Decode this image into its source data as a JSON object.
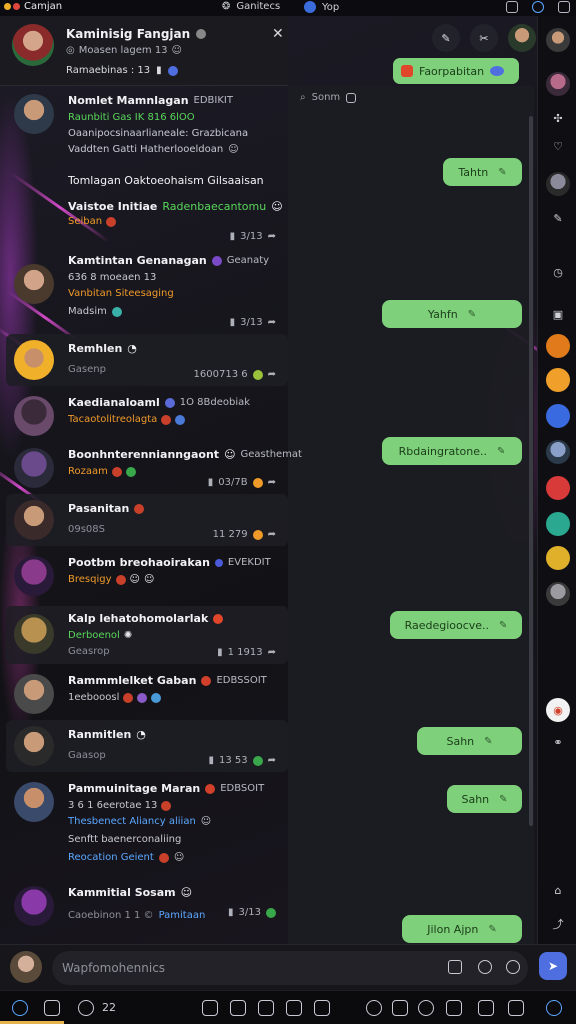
{
  "window": {
    "app_title": "Camjan",
    "tab1": "Ganitecs",
    "tab2": "Yop"
  },
  "chat_header": {
    "name": "Kaminisig Fangjan",
    "sub": "Moasen lagem 13",
    "meta": "Ramaebinas : 13"
  },
  "chats": [
    {
      "t1": "Nomlet Mamnlagan",
      "extra": "EDBIKIT",
      "t2": "Raunbiti Gas IK 816 6lOO",
      "t3": "Oaanipocsinaarlianeale: Grazbicana",
      "t4": "Vaddten Gatti Hatherlooeldoan"
    },
    {
      "t1": "Tomlagan Oaktoeohaism Gilsaaisan"
    },
    {
      "t1": "Vaistoe Initiae",
      "extra": "Radenbaecantomu",
      "t2": "Seiban",
      "meta": "3/13"
    },
    {
      "t1": "Kamtintan Genanagan",
      "extra": "Geanaty",
      "t2": "636 8 moeaen 13",
      "t3": "Vanbitan Siteesaging",
      "t4": "Madsim",
      "meta": "3/13"
    },
    {
      "t1": "Remhlen",
      "t3": "Gasenp",
      "meta": "1600713 6"
    },
    {
      "t1": "Kaedianaloaml",
      "extra": "1O 8Bdeobiak",
      "t2": "Tacaotolitreolagta"
    },
    {
      "t1": "Boonhnterennianngaont",
      "extra": "Geasthemat",
      "t2": "Rozaam",
      "meta": "03/7B"
    },
    {
      "t1": "Pasanitan",
      "t3": "09s08S",
      "meta": "11 279"
    },
    {
      "t1": "Pootbm breohaoirakan",
      "extra": "EVEKDIT",
      "t2": "Bresqigy"
    },
    {
      "t1": "Kalp lehatohomolarlak",
      "t2": "Derboenol",
      "t3": "Geasrop",
      "meta": "1 1913"
    },
    {
      "t1": "Rammmlelket Gaban",
      "extra": "EDBSSOIT",
      "t2": "1eebooosl"
    },
    {
      "t1": "Ranmitlen",
      "t3": "Gaasop",
      "meta": "13 53"
    },
    {
      "t1": "Pammuinitage Maran",
      "extra": "EDBSOIT",
      "t2": "3 6 1 6eerotae 13",
      "t3": "Thesbenect Aliancy aliian",
      "t4": "Senftt baenerconaliing",
      "t5": "Reocation Geient"
    },
    {
      "t1": "Kammitial Sosam",
      "t3": "Caoebinon 1 1 ©",
      "extra": "Pamitaan",
      "meta": "3/13"
    }
  ],
  "bubbles": {
    "top": "Faorpabitan",
    "b1": "Tahtn",
    "b2": "Yahfn",
    "b3": "Rbdaingratone..",
    "b4": "Raedegioocve..",
    "b5": "Sahn",
    "b6": "Sahn",
    "b7": "Jilon Ajpn"
  },
  "search": {
    "placeholder": "Sonm"
  },
  "composer": {
    "placeholder": "Wapfomohennics"
  },
  "taskbar": {
    "num": "22"
  },
  "colors": {
    "bubble": "#7ed07b",
    "accent": "#4f6fe0",
    "green_text": "#58d65a",
    "orange_text": "#f09a2a"
  }
}
